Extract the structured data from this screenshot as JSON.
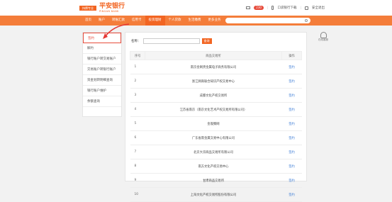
{
  "header": {
    "badge": "持牌专业",
    "brand": "平安银行",
    "brand_sub": "PINGAN BANK",
    "message_count": "230",
    "download_label": "口袋银行下载",
    "logout_label": "安全退出",
    "accent_color": "#f26522"
  },
  "nav": {
    "items": [
      "首页",
      "账户",
      "转账汇款",
      "信用卡",
      "投资理财",
      "个人贷款",
      "生活缴费",
      "更多业务"
    ],
    "active_index": 4
  },
  "sidebar": {
    "items": [
      "签约",
      "解约",
      "银行账户转交易账户",
      "交易账户转银行账户",
      "资金划转明细查询",
      "银行账户维护",
      "余额查询"
    ],
    "active_index": 0
  },
  "main": {
    "name_label": "名称：",
    "name_value": "",
    "query_label": "查询",
    "columns": [
      "序号",
      "商品交易所",
      "操作"
    ],
    "rows": [
      {
        "idx": "1",
        "name": "南京金网贵金属电子商务有限公司",
        "op": "签约"
      },
      {
        "idx": "2",
        "name": "浙江网商联合知识产权交易中心",
        "op": "签约"
      },
      {
        "idx": "3",
        "name": "成都文化产权交易所",
        "op": "签约"
      },
      {
        "idx": "4",
        "name": "江苏省南京（南京文化艺术产权交易所有限公司）",
        "op": "签约"
      },
      {
        "idx": "5",
        "name": "金观察网",
        "op": "签约"
      },
      {
        "idx": "6",
        "name": "广东省南金属交易中心有限公司",
        "op": "签约"
      },
      {
        "idx": "7",
        "name": "北京大宗商品交易所有限公司",
        "op": "签约"
      },
      {
        "idx": "8",
        "name": "南方文化产权交易中心",
        "op": "签约"
      },
      {
        "idx": "9",
        "name": "甘肃商品交易所",
        "op": "签约"
      },
      {
        "idx": "10",
        "name": "上海文化产权交易所股份有限公司",
        "op": "签约"
      }
    ]
  },
  "float_tool": {
    "label": "在线客服"
  },
  "icons": [
    "mail-icon",
    "phone-icon",
    "lock-icon",
    "search-icon",
    "service-icon",
    "annotation-arrow"
  ]
}
